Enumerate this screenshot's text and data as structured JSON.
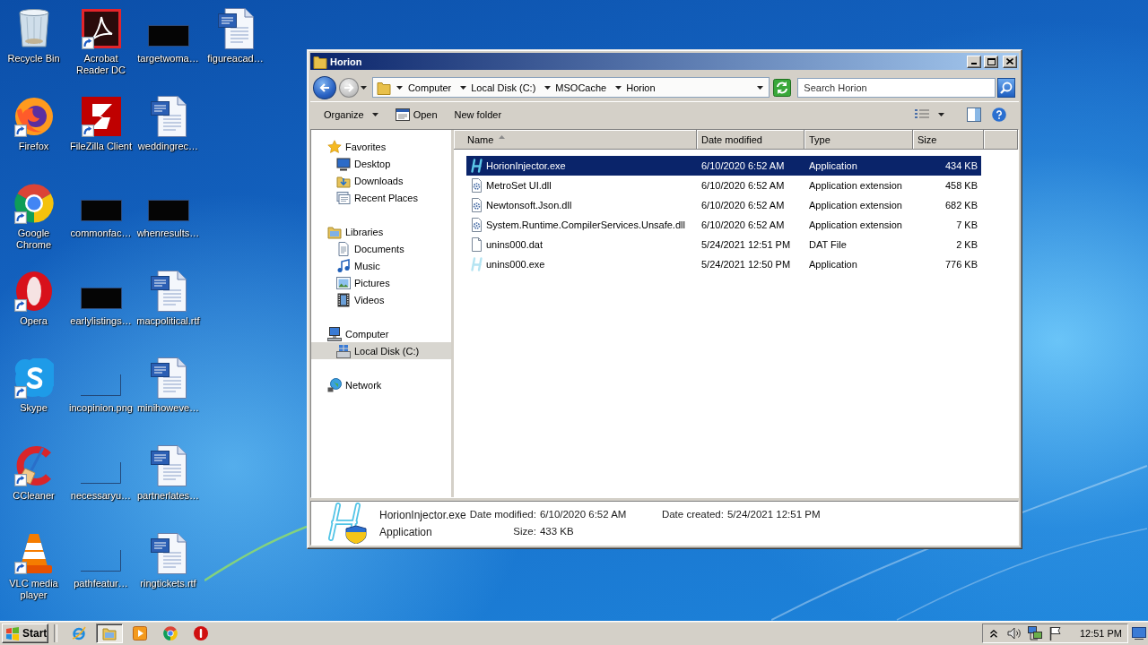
{
  "desktop": {
    "icons": [
      {
        "label": "Recycle Bin",
        "kind": "recycle-bin",
        "shortcut": false
      },
      {
        "label": "Firefox",
        "kind": "firefox",
        "shortcut": true
      },
      {
        "label": "Google Chrome",
        "kind": "chrome",
        "shortcut": true
      },
      {
        "label": "Opera",
        "kind": "opera",
        "shortcut": true
      },
      {
        "label": "Skype",
        "kind": "skype",
        "shortcut": true
      },
      {
        "label": "CCleaner",
        "kind": "ccleaner",
        "shortcut": true
      },
      {
        "label": "VLC media player",
        "kind": "vlc",
        "shortcut": true
      },
      {
        "label": "Acrobat Reader DC",
        "kind": "acrobat",
        "shortcut": true
      },
      {
        "label": "FileZilla Client",
        "kind": "filezilla",
        "shortcut": true
      },
      {
        "label": "commonfac…",
        "kind": "dark-thumbnail",
        "shortcut": false
      },
      {
        "label": "earlylistings…",
        "kind": "dark-thumbnail",
        "shortcut": false
      },
      {
        "label": "incopinion.png",
        "kind": "blank-thumbnail",
        "shortcut": false
      },
      {
        "label": "necessaryu…",
        "kind": "blank-thumbnail",
        "shortcut": false
      },
      {
        "label": "pathfeatur…",
        "kind": "blank-thumbnail",
        "shortcut": false
      },
      {
        "label": "targetwoma…",
        "kind": "dark-thumbnail",
        "shortcut": false
      },
      {
        "label": "weddingrec…",
        "kind": "word-doc",
        "shortcut": false
      },
      {
        "label": "whenresults…",
        "kind": "dark-thumbnail",
        "shortcut": false
      },
      {
        "label": "macpolitical.rtf",
        "kind": "word-doc",
        "shortcut": false
      },
      {
        "label": "minihoweve…",
        "kind": "word-doc",
        "shortcut": false
      },
      {
        "label": "partnerlates…",
        "kind": "word-doc",
        "shortcut": false
      },
      {
        "label": "ringtickets.rtf",
        "kind": "word-doc",
        "shortcut": false
      },
      {
        "label": "figureacad…",
        "kind": "word-doc",
        "shortcut": false
      }
    ]
  },
  "explorer": {
    "title": "Horion",
    "breadcrumbs": [
      "Computer",
      "Local Disk (C:)",
      "MSOCache",
      "Horion"
    ],
    "search": {
      "placeholder": "Search Horion"
    },
    "toolbar": [
      {
        "label": "Organize",
        "kind": "menu"
      },
      {
        "label": "Open",
        "kind": "open"
      },
      {
        "label": "New folder",
        "kind": "plain"
      }
    ],
    "navigation": [
      {
        "label": "Favorites",
        "kind": "star",
        "selected": false,
        "children": [
          {
            "label": "Desktop",
            "kind": "desktop",
            "selected": false
          },
          {
            "label": "Downloads",
            "kind": "downloads",
            "selected": false
          },
          {
            "label": "Recent Places",
            "kind": "recent",
            "selected": false
          }
        ]
      },
      {
        "label": "Libraries",
        "kind": "libraries",
        "selected": false,
        "children": [
          {
            "label": "Documents",
            "kind": "documents",
            "selected": false
          },
          {
            "label": "Music",
            "kind": "music",
            "selected": false
          },
          {
            "label": "Pictures",
            "kind": "pictures",
            "selected": false
          },
          {
            "label": "Videos",
            "kind": "videos",
            "selected": false
          }
        ]
      },
      {
        "label": "Computer",
        "kind": "computer",
        "selected": false,
        "children": [
          {
            "label": "Local Disk (C:)",
            "kind": "disk",
            "selected": true
          }
        ]
      },
      {
        "label": "Network",
        "kind": "network",
        "selected": false
      }
    ],
    "columns": [
      {
        "label": "Name",
        "sorted": true
      },
      {
        "label": "Date modified",
        "sorted": false
      },
      {
        "label": "Type",
        "sorted": false
      },
      {
        "label": "Size",
        "sorted": false
      }
    ],
    "files": [
      {
        "name": "HorionInjector.exe",
        "date": "6/10/2020 6:52 AM",
        "type": "Application",
        "size": "434 KB",
        "kind": "app",
        "selected": true
      },
      {
        "name": "MetroSet UI.dll",
        "date": "6/10/2020 6:52 AM",
        "type": "Application extension",
        "size": "458 KB",
        "kind": "dll",
        "selected": false
      },
      {
        "name": "Newtonsoft.Json.dll",
        "date": "6/10/2020 6:52 AM",
        "type": "Application extension",
        "size": "682 KB",
        "kind": "dll",
        "selected": false
      },
      {
        "name": "System.Runtime.CompilerServices.Unsafe.dll",
        "date": "6/10/2020 6:52 AM",
        "type": "Application extension",
        "size": "7 KB",
        "kind": "dll",
        "selected": false
      },
      {
        "name": "unins000.dat",
        "date": "5/24/2021 12:51 PM",
        "type": "DAT File",
        "size": "2 KB",
        "kind": "blank",
        "selected": false
      },
      {
        "name": "unins000.exe",
        "date": "5/24/2021 12:50 PM",
        "type": "Application",
        "size": "776 KB",
        "kind": "app-faded",
        "selected": false
      }
    ],
    "details": {
      "name": "HorionInjector.exe",
      "type": "Application",
      "fields": [
        {
          "label": "Date modified:",
          "value": "6/10/2020 6:52 AM"
        },
        {
          "label": "Date created:",
          "value": "5/24/2021 12:51 PM"
        },
        {
          "label": "Size:",
          "value": "433 KB"
        }
      ]
    }
  },
  "taskbar": {
    "start": "Start",
    "apps": [
      {
        "kind": "ie",
        "active": false
      },
      {
        "kind": "explorer",
        "active": true
      },
      {
        "kind": "media-player",
        "active": false
      },
      {
        "kind": "chrome",
        "active": false
      },
      {
        "kind": "stop",
        "active": false
      }
    ],
    "clock": "12:51 PM"
  }
}
